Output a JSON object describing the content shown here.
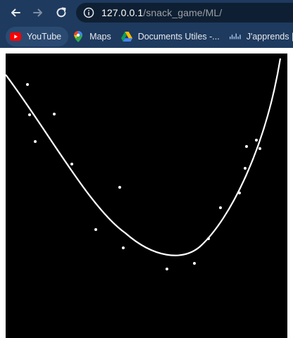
{
  "browser": {
    "url_host": "127.0.0.1",
    "url_path": "/snack_game/ML/",
    "bookmarks": [
      {
        "label": "YouTube",
        "icon": "youtube-icon"
      },
      {
        "label": "Maps",
        "icon": "maps-icon"
      },
      {
        "label": "Documents Utiles -...",
        "icon": "google-drive-icon"
      },
      {
        "label": "J'apprends | ",
        "icon": "cisco-icon"
      }
    ]
  },
  "colors": {
    "toolbar": "#1e3a5f",
    "omnibox": "#0f1f33",
    "canvas": "#000000",
    "curve": "#ffffff",
    "points": "#ffffff"
  }
}
